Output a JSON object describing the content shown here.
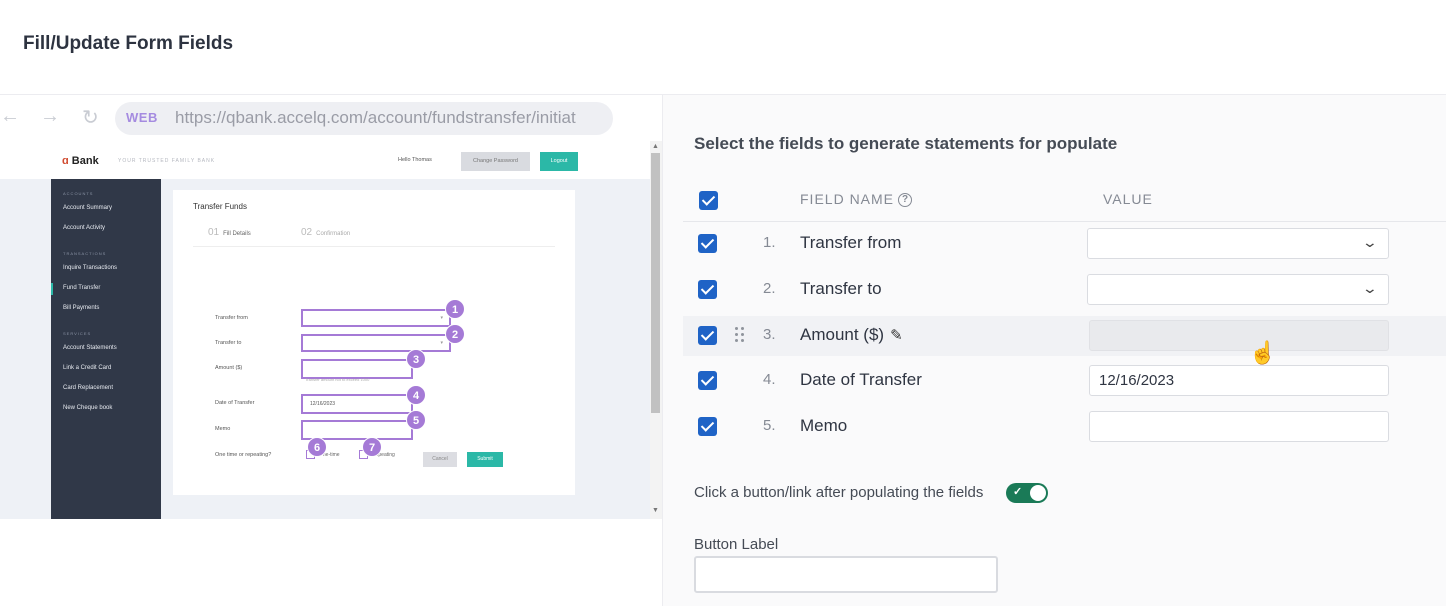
{
  "page": {
    "title": "Fill/Update Form Fields"
  },
  "browser": {
    "back_icon": "arrow-left-icon",
    "forward_icon": "arrow-right-icon",
    "reload_icon": "reload-icon",
    "url_tag": "WEB",
    "url": "https://qbank.accelq.com/account/fundstransfer/initiat"
  },
  "site": {
    "logo_mark": "ɑ",
    "logo_text": "Bank",
    "tagline": "YOUR TRUSTED FAMILY BANK",
    "greeting": "Hello Thomas",
    "change_password": "Change Password",
    "logout": "Logout",
    "nav": [
      {
        "type": "section",
        "label": "ACCOUNTS"
      },
      {
        "type": "link",
        "label": "Account Summary"
      },
      {
        "type": "link",
        "label": "Account Activity"
      },
      {
        "type": "section",
        "label": "TRANSACTIONS"
      },
      {
        "type": "link",
        "label": "Inquire Transactions"
      },
      {
        "type": "link",
        "label": "Fund Transfer",
        "active": true
      },
      {
        "type": "link",
        "label": "Bill Payments"
      },
      {
        "type": "section",
        "label": "SERVICES"
      },
      {
        "type": "link",
        "label": "Account Statements"
      },
      {
        "type": "link",
        "label": "Link a Credit Card"
      },
      {
        "type": "link",
        "label": "Card Replacement"
      },
      {
        "type": "link",
        "label": "New Cheque book"
      }
    ],
    "card_title": "Transfer Funds",
    "steps": [
      {
        "num": "01",
        "label": "Fill Details"
      },
      {
        "num": "02",
        "label": "Confirmation"
      }
    ],
    "fields": {
      "transfer_from": "Transfer from",
      "transfer_to": "Transfer to",
      "amount": "Amount ($)",
      "amount_hint": "Transfer amount not to exceed 1000",
      "date": "Date of Transfer",
      "date_value": "12/16/2023",
      "memo": "Memo",
      "repeat": "One time or repeating?",
      "one_time": "One-time",
      "repeating": "Repeating"
    },
    "badges": [
      "1",
      "2",
      "3",
      "4",
      "5",
      "6",
      "7"
    ],
    "cancel": "Cancel",
    "submit": "Submit"
  },
  "panel": {
    "heading": "Select the fields to generate statements for populate",
    "col_field": "FIELD NAME",
    "col_value": "VALUE",
    "help_glyph": "?",
    "rows": [
      {
        "index": "1.",
        "name": "Transfer from",
        "control": "select",
        "value": "",
        "checked": true
      },
      {
        "index": "2.",
        "name": "Transfer to",
        "control": "select",
        "value": "",
        "checked": true
      },
      {
        "index": "3.",
        "name": "Amount ($)",
        "control": "input-disabled",
        "value": "",
        "checked": true,
        "hovered": true
      },
      {
        "index": "4.",
        "name": "Date of Transfer",
        "control": "input",
        "value": "12/16/2023",
        "checked": true
      },
      {
        "index": "5.",
        "name": "Memo",
        "control": "input",
        "value": "",
        "checked": true
      }
    ],
    "toggle_label": "Click a button/link after populating the fields",
    "toggle_on": true,
    "button_label": "Button Label",
    "button_label_value": ""
  },
  "colors": {
    "checkbox": "#1f63c6",
    "toggle": "#1a7a57",
    "highlight": "#a57ad6",
    "site_accent": "#2bb8a7"
  }
}
